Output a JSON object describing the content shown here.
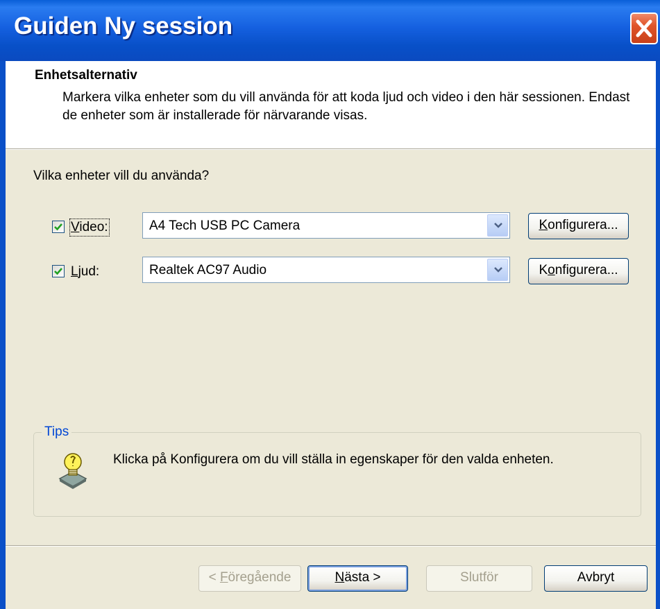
{
  "window": {
    "title": "Guiden Ny session"
  },
  "header": {
    "title": "Enhetsalternativ",
    "description": "Markera vilka enheter som du vill använda för att koda ljud och video i den här sessionen. Endast de enheter som är installerade för närvarande visas."
  },
  "question": "Vilka enheter vill du använda?",
  "devices": [
    {
      "label_accel": "V",
      "label_rest": "ideo:",
      "checked": true,
      "value": "A4 Tech USB PC Camera",
      "configure_accel": "K",
      "configure_rest": "onfigurera..."
    },
    {
      "label_accel": "L",
      "label_rest": "jud:",
      "checked": true,
      "value": "Realtek AC97 Audio",
      "configure_pre": "K",
      "configure_accel": "o",
      "configure_rest": "nfigurera..."
    }
  ],
  "tips": {
    "legend": "Tips",
    "text": "Klicka på Konfigurera om du vill ställa in egenskaper för den valda enheten."
  },
  "footer": {
    "back_pre": "< ",
    "back_accel": "F",
    "back_rest": "öregående",
    "next_accel": "N",
    "next_rest": "ästa >",
    "finish": "Slutför",
    "cancel": "Avbryt"
  },
  "colors": {
    "titlebar": "#0a50c8",
    "background": "#ece9d8",
    "accent": "#0046d5"
  },
  "icons": [
    "close-icon",
    "checkmark-icon",
    "dropdown-arrow-icon",
    "lightbulb-tip-icon"
  ]
}
